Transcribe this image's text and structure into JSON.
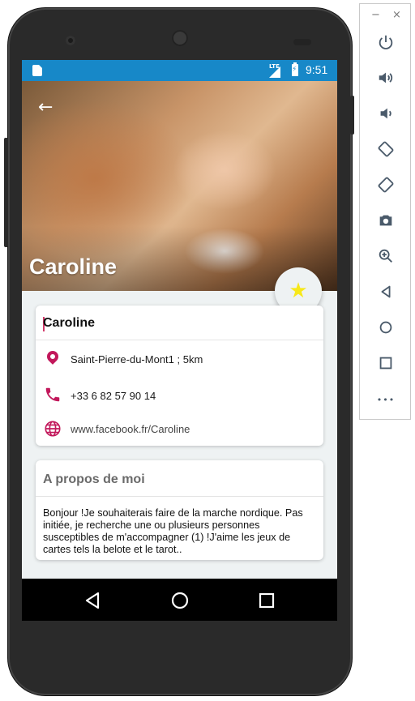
{
  "statusbar": {
    "network": "LTE",
    "time": "9:51"
  },
  "profile": {
    "hero_name": "Caroline",
    "name": "Caroline",
    "location": "Saint-Pierre-du-Mont1 ; 5km",
    "phone": "+33 6 82 57 90 14",
    "website": "www.facebook.fr/Caroline"
  },
  "about": {
    "title": "A propos de moi",
    "text": "Bonjour !Je souhaiterais faire de la marche nordique. Pas initiée, je recherche une ou plusieurs personnes susceptibles de m'accompagner (1) !J'aime les jeux de cartes tels la belote et le tarot.."
  },
  "colors": {
    "statusbar": "#1788c8",
    "accent": "#c2185b",
    "fab_star": "#f7e81a"
  },
  "icons": {
    "back": "arrow-left-icon",
    "location": "location-pin-icon",
    "phone": "phone-icon",
    "web": "globe-icon",
    "favorite": "star-icon"
  },
  "window": {
    "minimize": "−",
    "close": "×",
    "more": "•••"
  }
}
